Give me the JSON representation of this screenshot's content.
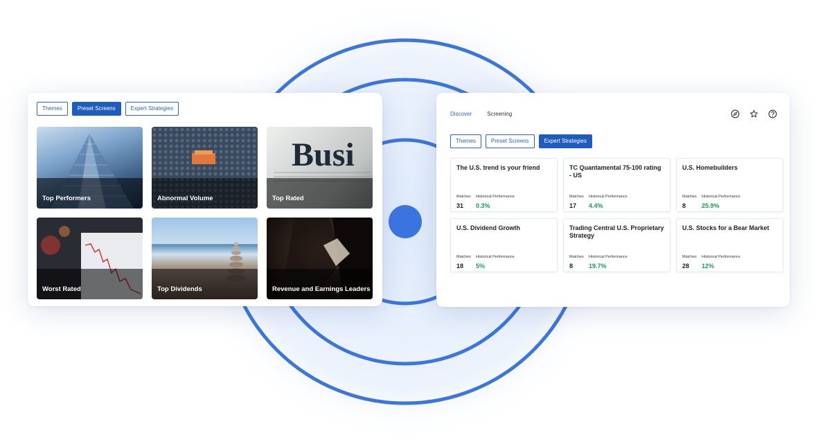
{
  "colors": {
    "accent": "#1f5cc0",
    "positive": "#1f9a5a",
    "ring": "#3b75e0"
  },
  "left_panel": {
    "tabs": [
      {
        "label": "Themes",
        "active": false
      },
      {
        "label": "Preset Screens",
        "active": true
      },
      {
        "label": "Expert Strategies",
        "active": false
      }
    ],
    "tiles": [
      {
        "label": "Top Performers",
        "image": "skyscraper"
      },
      {
        "label": "Abnormal Volume",
        "image": "blocks"
      },
      {
        "label": "Top Rated",
        "image": "newspaper"
      },
      {
        "label": "Worst Rated",
        "image": "stock-chart"
      },
      {
        "label": "Top Dividends",
        "image": "stacked-stones"
      },
      {
        "label": "Revenue and Earnings Leaders",
        "image": "businessman"
      }
    ],
    "newspaper_text": "Busi"
  },
  "right_panel": {
    "nav": [
      {
        "label": "Discover",
        "active": true
      },
      {
        "label": "Screening",
        "active": false
      }
    ],
    "icons": [
      "compass-icon",
      "star-icon",
      "help-icon"
    ],
    "tabs": [
      {
        "label": "Themes",
        "active": false
      },
      {
        "label": "Preset Screens",
        "active": false
      },
      {
        "label": "Expert Strategies",
        "active": true
      }
    ],
    "matches_label": "Matches",
    "perf_label": "Historical Performance",
    "strategies": [
      {
        "title": "The U.S. trend is your friend",
        "matches": "31",
        "performance": "0.3%"
      },
      {
        "title": "TC Quantamental 75-100 rating - US",
        "matches": "17",
        "performance": "4.4%"
      },
      {
        "title": "U.S. Homebuilders",
        "matches": "8",
        "performance": "25.9%"
      },
      {
        "title": "U.S. Dividend Growth",
        "matches": "18",
        "performance": "5%"
      },
      {
        "title": "Trading Central U.S. Proprietary Strategy",
        "matches": "8",
        "performance": "19.7%"
      },
      {
        "title": "U.S. Stocks for a Bear Market",
        "matches": "28",
        "performance": "12%"
      }
    ]
  }
}
